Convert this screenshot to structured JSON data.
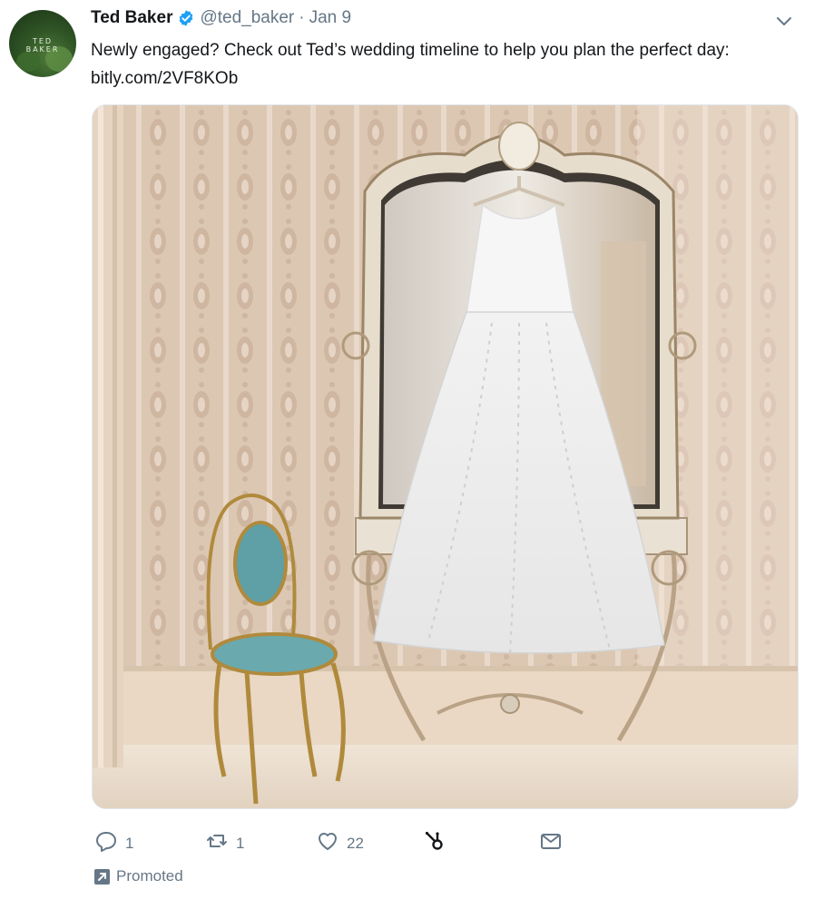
{
  "tweet": {
    "author_name": "Ted Baker",
    "handle": "@ted_baker",
    "separator": "·",
    "date": "Jan 9",
    "text": "Newly engaged? Check out Ted’s wedding timeline to help you plan the perfect day: bitly.com/2VF8KOb",
    "avatar_text": "TED BAKER"
  },
  "actions": {
    "reply_count": "1",
    "retweet_count": "1",
    "like_count": "22",
    "share_count": "",
    "dm_count": ""
  },
  "promoted_label": "Promoted",
  "colors": {
    "verified": "#1da1f2",
    "muted": "#657786",
    "text": "#14171a"
  },
  "icons": [
    "verified-badge-icon",
    "caret-down-icon",
    "reply-icon",
    "retweet-icon",
    "like-icon",
    "hubspot-icon",
    "message-icon",
    "promoted-icon"
  ]
}
